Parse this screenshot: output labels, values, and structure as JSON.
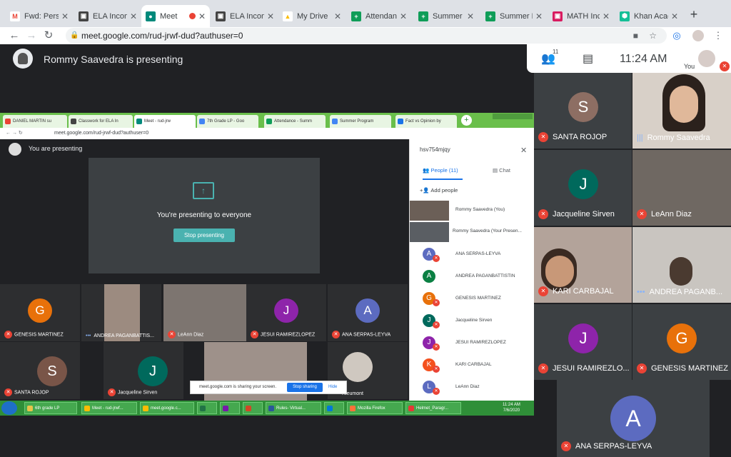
{
  "browser": {
    "tabs": [
      {
        "label": "Fwd: Perso",
        "icon": "gmail-icon",
        "color": "#ea4335",
        "letter": "M"
      },
      {
        "label": "ELA Incom",
        "icon": "classroom-icon",
        "color": "#444444",
        "letter": "▣"
      },
      {
        "label": "Meet",
        "icon": "meet-icon",
        "color": "#00897b",
        "letter": "●"
      },
      {
        "label": "ELA Incom",
        "icon": "classroom-icon",
        "color": "#444444",
        "letter": "▣"
      },
      {
        "label": "My Drive",
        "icon": "drive-icon",
        "color": "#fbbc04",
        "letter": "▲"
      },
      {
        "label": "Attendance",
        "icon": "sheets-icon",
        "color": "#0f9d58",
        "letter": "+"
      },
      {
        "label": "Summer P",
        "icon": "sheets-icon",
        "color": "#0f9d58",
        "letter": "+"
      },
      {
        "label": "Summer P",
        "icon": "sheets-icon",
        "color": "#0f9d58",
        "letter": "+"
      },
      {
        "label": "MATH Inco",
        "icon": "classroom-icon",
        "color": "#d81b60",
        "letter": "▣"
      },
      {
        "label": "Khan Acad",
        "icon": "khan-icon",
        "color": "#14bf96",
        "letter": "⬢"
      }
    ],
    "url": "meet.google.com/rud-jrwf-dud?authuser=0"
  },
  "meet": {
    "presenting_text": "Rommy Saavedra is presenting",
    "participant_count": "11",
    "time": "11:24 AM",
    "you_label": "You"
  },
  "shared": {
    "tabs": [
      "DANIEL MARTIN su",
      "Classwork for ELA In",
      "Meet - rud-jrw",
      "7th Grade LP - Goo",
      "Attendance - Summ",
      "Summer Program",
      "Fact vs Opinion by"
    ],
    "url": "meet.google.com/rud-jrwf-dud?authuser=0",
    "you_presenting": "You are presenting",
    "presenting_everyone": "You're presenting to everyone",
    "stop_presenting": "Stop presenting",
    "grid": [
      {
        "name": "GENESIS MARTINEZ",
        "letter": "G",
        "color": "#e8710a"
      },
      {
        "name": "ANDREA PAGANBATTIS...",
        "letter": "",
        "color": ""
      },
      {
        "name": "LeAnn Diaz",
        "letter": "",
        "color": ""
      },
      {
        "name": "JESUI RAMIREZLOPEZ",
        "letter": "J",
        "color": "#8e24aa"
      },
      {
        "name": "ANA SERPAS-LEYVA",
        "letter": "A",
        "color": "#5c6bc0"
      },
      {
        "name": "SANTA ROJOP",
        "letter": "S",
        "color": "#795548"
      },
      {
        "name": "Jacqueline Sirven",
        "letter": "J",
        "color": "#00695c"
      },
      {
        "name": "",
        "letter": "",
        "color": ""
      },
      {
        "name": "Rleumont",
        "letter": "",
        "color": ""
      }
    ],
    "side": {
      "code": "hsv754mjqy",
      "people_tab": "People (11)",
      "chat_tab": "Chat",
      "add_people": "Add people",
      "people": [
        {
          "name": "Rommy Saavedra (You)",
          "letter": "",
          "color": ""
        },
        {
          "name": "Rommy Saavedra (Your Presen...",
          "letter": "",
          "color": ""
        },
        {
          "name": "ANA SERPAS-LEYVA",
          "letter": "A",
          "color": "#5c6bc0"
        },
        {
          "name": "ANDREA PAGANBATTISTIN",
          "letter": "A",
          "color": "#0b8043"
        },
        {
          "name": "GENESIS MARTINEZ",
          "letter": "G",
          "color": "#e8710a"
        },
        {
          "name": "Jacqueline Sirven",
          "letter": "J",
          "color": "#00695c"
        },
        {
          "name": "JESUI RAMIREZLOPEZ",
          "letter": "J",
          "color": "#8e24aa"
        },
        {
          "name": "KARI CARBAJAL",
          "letter": "K",
          "color": "#f4511e"
        },
        {
          "name": "LeAnn Diaz",
          "letter": "L",
          "color": "#5c6bc0"
        }
      ]
    },
    "share_notice": "meet.google.com is sharing your screen.",
    "stop_sharing": "Stop sharing",
    "hide": "Hide",
    "taskbar": [
      "6th grade LP",
      "Meet - rud-jrwf...",
      "meet.google.c...",
      "",
      "",
      "",
      "Rules- Virtual...",
      "",
      "Mozilla Firefox",
      "Helmet_Paragr..."
    ],
    "clock_time": "11:24 AM",
    "clock_date": "7/6/2020"
  },
  "tiles": [
    {
      "name": "SANTA ROJOP",
      "letter": "S",
      "color": "#8d6e63",
      "video": false
    },
    {
      "name": "Rommy Saavedra",
      "letter": "",
      "color": "",
      "video": true
    },
    {
      "name": "Jacqueline Sirven",
      "letter": "J",
      "color": "#00695c",
      "video": false
    },
    {
      "name": "LeAnn Diaz",
      "letter": "",
      "color": "",
      "video": true
    },
    {
      "name": "KARI CARBAJAL",
      "letter": "",
      "color": "",
      "video": true
    },
    {
      "name": "ANDREA PAGANB...",
      "letter": "",
      "color": "",
      "video": true
    },
    {
      "name": "JESUI RAMIREZLO...",
      "letter": "J",
      "color": "#8e24aa",
      "video": false
    },
    {
      "name": "GENESIS MARTINEZ",
      "letter": "G",
      "color": "#e8710a",
      "video": false
    }
  ],
  "big_tile": {
    "name": "ANA SERPAS-LEYVA",
    "letter": "A"
  }
}
